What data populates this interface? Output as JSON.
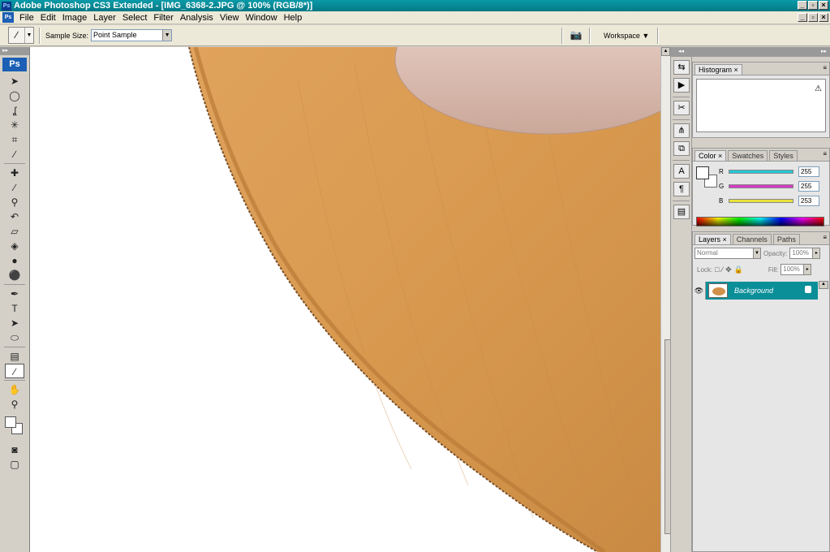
{
  "window": {
    "title": "Adobe Photoshop CS3 Extended - [IMG_6368-2.JPG @ 100% (RGB/8*)]",
    "app_badge": "Ps"
  },
  "menu": [
    "File",
    "Edit",
    "Image",
    "Layer",
    "Select",
    "Filter",
    "Analysis",
    "View",
    "Window",
    "Help"
  ],
  "options": {
    "sample_size_label": "Sample Size:",
    "sample_size_value": "Point Sample",
    "workspace_label": "Workspace ▼"
  },
  "toolbox": {
    "logo": "Ps",
    "tools": [
      {
        "name": "move-tool",
        "glyph": "➤"
      },
      {
        "name": "marquee-tool",
        "glyph": "◯"
      },
      {
        "name": "lasso-tool",
        "glyph": "ʆ"
      },
      {
        "name": "magic-wand-tool",
        "glyph": "✳"
      },
      {
        "name": "crop-tool",
        "glyph": "⌗"
      },
      {
        "name": "slice-tool",
        "glyph": "∕"
      },
      {
        "name": "healing-brush-tool",
        "glyph": "✚"
      },
      {
        "name": "brush-tool",
        "glyph": "∕"
      },
      {
        "name": "clone-stamp-tool",
        "glyph": "⚲"
      },
      {
        "name": "history-brush-tool",
        "glyph": "↶"
      },
      {
        "name": "eraser-tool",
        "glyph": "▱"
      },
      {
        "name": "paint-bucket-tool",
        "glyph": "◈"
      },
      {
        "name": "blur-tool",
        "glyph": "●"
      },
      {
        "name": "dodge-tool",
        "glyph": "⚫"
      },
      {
        "name": "pen-tool",
        "glyph": "✒"
      },
      {
        "name": "type-tool",
        "glyph": "T"
      },
      {
        "name": "path-selection-tool",
        "glyph": "➤"
      },
      {
        "name": "shape-tool",
        "glyph": "⬭"
      },
      {
        "name": "notes-tool",
        "glyph": "▤"
      },
      {
        "name": "eyedropper-tool",
        "glyph": "∕"
      },
      {
        "name": "hand-tool",
        "glyph": "✋"
      },
      {
        "name": "zoom-tool",
        "glyph": "⚲"
      }
    ]
  },
  "panels": {
    "histogram": {
      "tab": "Histogram ×"
    },
    "color": {
      "tabs": [
        "Color ×",
        "Swatches",
        "Styles"
      ],
      "channels": [
        {
          "label": "R",
          "value": "255",
          "color": "#27c8d8"
        },
        {
          "label": "G",
          "value": "255",
          "color": "#d63bc6"
        },
        {
          "label": "B",
          "value": "253",
          "color": "#e8e23a"
        }
      ]
    },
    "layers": {
      "tabs": [
        "Layers ×",
        "Channels",
        "Paths"
      ],
      "blend_mode": "Normal",
      "opacity_label": "Opacity:",
      "opacity_value": "100%",
      "lock_label": "Lock:",
      "fill_label": "Fill:",
      "fill_value": "100%",
      "layer_name": "Background"
    }
  },
  "colors": {
    "title_bar": "#0a9aa8",
    "selected_layer": "#0a8f99",
    "wood": "#d9994f"
  }
}
